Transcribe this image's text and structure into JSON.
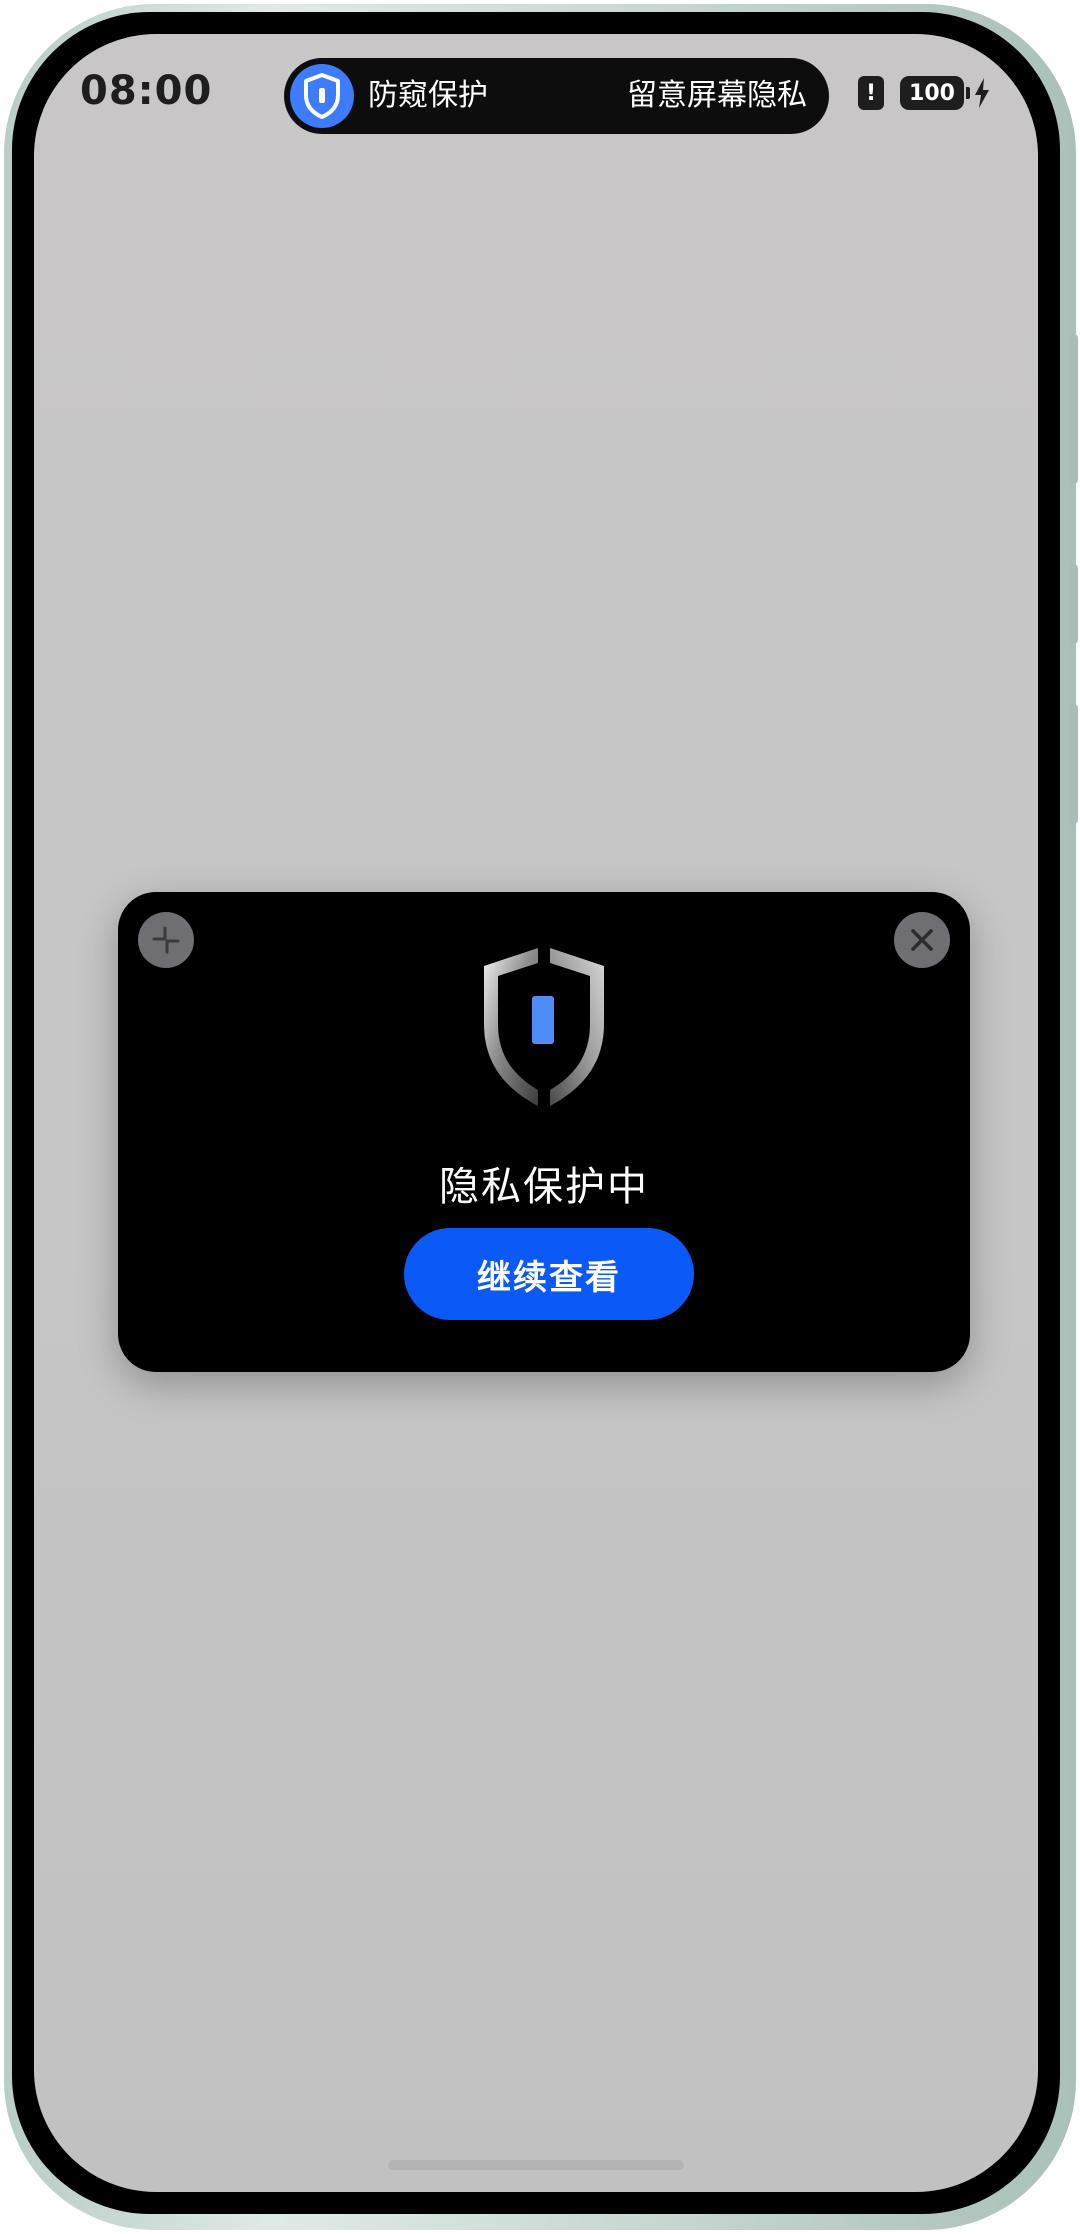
{
  "status_bar": {
    "time": "08:00",
    "battery_level": "100",
    "alert_icon": "alert-icon",
    "charging_icon": "lightning-icon"
  },
  "capsule": {
    "icon": "shield-icon",
    "left_label": "防窥保护",
    "right_label": "留意屏幕隐私",
    "accent_color": "#3d7cff"
  },
  "privacy_card": {
    "title": "隐私保护中",
    "continue_label": "继续查看",
    "minimize_icon": "minimize-icon",
    "close_icon": "close-icon",
    "shield_icon": "shield-icon",
    "button_color": "#0b59f6"
  }
}
